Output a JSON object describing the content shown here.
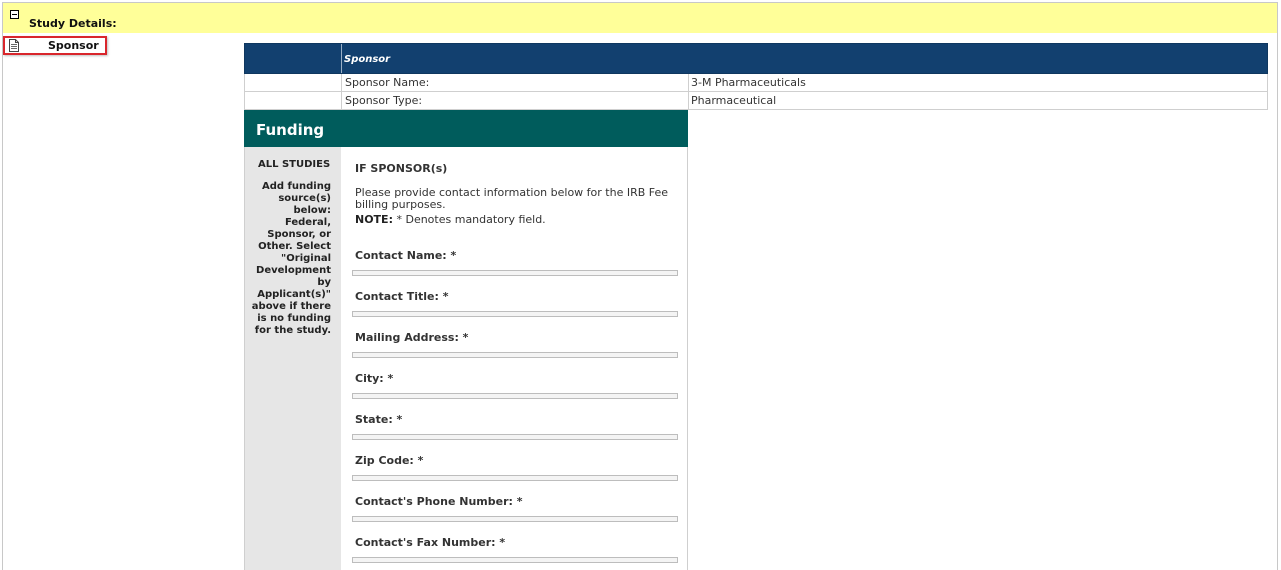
{
  "study": {
    "title": "Study Details:"
  },
  "nav": {
    "sponsor_label": "Sponsor"
  },
  "sponsor_table": {
    "header": "Sponsor",
    "rows": [
      {
        "label": "Sponsor Name:",
        "value": "3-M Pharmaceuticals"
      },
      {
        "label": "Sponsor Type:",
        "value": "Pharmaceutical"
      }
    ]
  },
  "funding": {
    "title": "Funding",
    "left": {
      "heading": "ALL STUDIES",
      "description": "Add funding source(s) below: Federal, Sponsor, or Other. Select \"Original Development by Applicant(s)\" above if there is no funding for the study."
    },
    "right": {
      "heading": "IF SPONSOR(s)",
      "instructions": "Please provide contact information below for the IRB Fee billing purposes.",
      "note_label": "NOTE:",
      "note_text": " * Denotes mandatory field.",
      "fields": [
        {
          "label": "Contact Name: *",
          "value": ""
        },
        {
          "label": "Contact Title: *",
          "value": ""
        },
        {
          "label": "Mailing Address: *",
          "value": ""
        },
        {
          "label": "City: *",
          "value": ""
        },
        {
          "label": "State: *",
          "value": ""
        },
        {
          "label": "Zip Code: *",
          "value": ""
        },
        {
          "label": "Contact's Phone Number: *",
          "value": ""
        },
        {
          "label": "Contact's Fax Number: *",
          "value": ""
        }
      ]
    }
  },
  "colors": {
    "study_bar": "#ffff99",
    "sponsor_header": "#12406f",
    "funding_header": "#005c5c",
    "highlight_border": "#d9262c"
  }
}
